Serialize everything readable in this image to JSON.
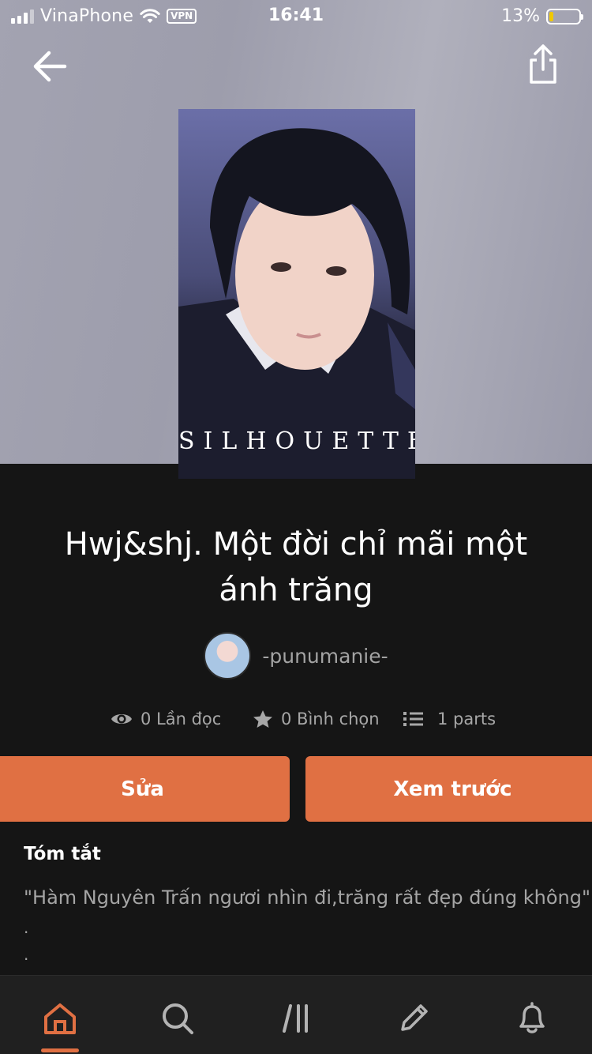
{
  "status_bar": {
    "carrier": "VinaPhone",
    "vpn": "VPN",
    "time": "16:41",
    "battery_percent": "13%",
    "battery_level": 0.13
  },
  "header": {
    "back_icon": "arrow-left-icon",
    "share_icon": "share-icon"
  },
  "cover": {
    "text": "SILHOUETTE"
  },
  "story": {
    "title": "Hwj&shj. Một đời chỉ mãi một ánh trăng",
    "author": "-punumanie-"
  },
  "stats": {
    "reads": "0 Lần đọc",
    "votes": "0 Bình chọn",
    "parts": "1 parts"
  },
  "actions": {
    "edit_label": "Sửa",
    "preview_label": "Xem trước"
  },
  "summary": {
    "label": "Tóm tắt",
    "text": "\"Hàm Nguyên Trấn ngươi nhìn đi,trăng rất đẹp đúng không\"",
    "dot1": ".",
    "dot2": "."
  },
  "colors": {
    "accent": "#e07043",
    "background": "#151515",
    "nav_background": "#202020"
  },
  "bottom_nav": {
    "items": [
      "home-icon",
      "search-icon",
      "library-icon",
      "write-icon",
      "notifications-icon"
    ],
    "active": "home-icon"
  }
}
